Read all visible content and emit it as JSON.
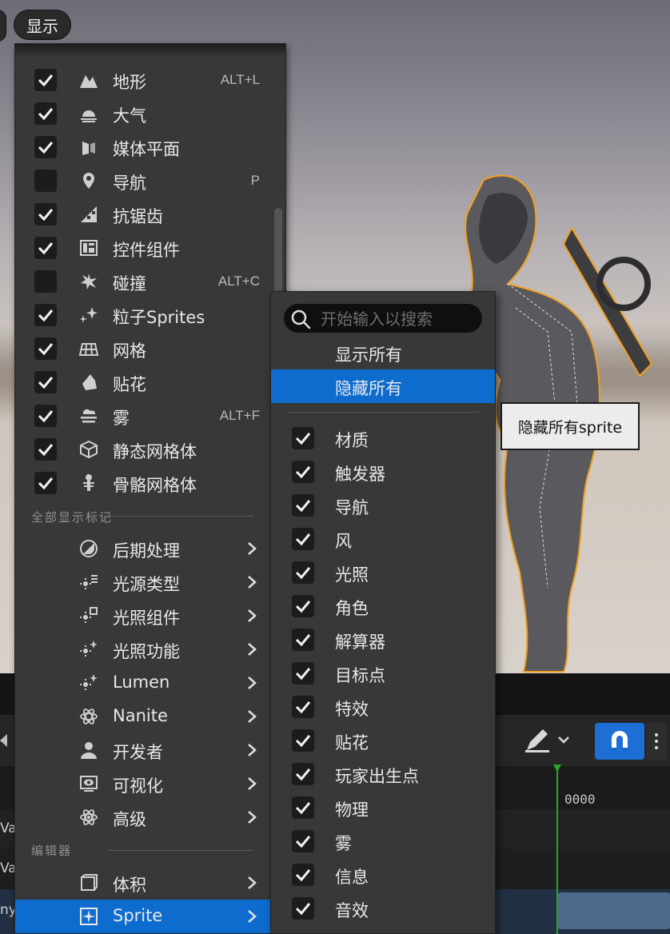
{
  "toolbar": {
    "show_label": "显示"
  },
  "show_menu": {
    "items": [
      {
        "label": "地形",
        "shortcut": "ALT+L",
        "checked": true,
        "icon": "landscape-icon"
      },
      {
        "label": "大气",
        "shortcut": "",
        "checked": true,
        "icon": "atmosphere-icon"
      },
      {
        "label": "媒体平面",
        "shortcut": "",
        "checked": true,
        "icon": "media-plane-icon"
      },
      {
        "label": "导航",
        "shortcut": "P",
        "checked": false,
        "icon": "navigation-pin-icon"
      },
      {
        "label": "抗锯齿",
        "shortcut": "",
        "checked": true,
        "icon": "anti-aliasing-icon"
      },
      {
        "label": "控件组件",
        "shortcut": "",
        "checked": true,
        "icon": "widget-component-icon"
      },
      {
        "label": "碰撞",
        "shortcut": "ALT+C",
        "checked": false,
        "icon": "collision-icon"
      },
      {
        "label": "粒子Sprites",
        "shortcut": "",
        "checked": true,
        "icon": "particle-sprites-icon"
      },
      {
        "label": "网格",
        "shortcut": "",
        "checked": true,
        "icon": "grid-icon"
      },
      {
        "label": "贴花",
        "shortcut": "",
        "checked": true,
        "icon": "decal-icon"
      },
      {
        "label": "雾",
        "shortcut": "ALT+F",
        "checked": true,
        "icon": "fog-icon"
      },
      {
        "label": "静态网格体",
        "shortcut": "",
        "checked": true,
        "icon": "static-mesh-icon"
      },
      {
        "label": "骨骼网格体",
        "shortcut": "",
        "checked": true,
        "icon": "skeletal-mesh-icon"
      }
    ],
    "section_all_flags": "全部显示标记",
    "submenus": [
      {
        "label": "后期处理",
        "icon": "post-process-icon"
      },
      {
        "label": "光源类型",
        "icon": "light-types-icon"
      },
      {
        "label": "光照组件",
        "icon": "lighting-components-icon"
      },
      {
        "label": "光照功能",
        "icon": "lighting-features-icon"
      },
      {
        "label": "Lumen",
        "icon": "lumen-icon"
      },
      {
        "label": "Nanite",
        "icon": "nanite-icon"
      },
      {
        "label": "开发者",
        "icon": "developer-icon"
      },
      {
        "label": "可视化",
        "icon": "visualize-icon"
      },
      {
        "label": "高级",
        "icon": "advanced-icon"
      }
    ],
    "section_editor": "编辑器",
    "editor_submenus": [
      {
        "label": "体积",
        "icon": "volume-icon",
        "selected": false
      },
      {
        "label": "Sprite",
        "icon": "sprite-icon",
        "selected": true
      }
    ]
  },
  "sprite_menu": {
    "search_placeholder": "开始输入以搜索",
    "show_all": "显示所有",
    "hide_all": "隐藏所有",
    "items": [
      {
        "label": "材质",
        "checked": true
      },
      {
        "label": "触发器",
        "checked": true
      },
      {
        "label": "导航",
        "checked": true
      },
      {
        "label": "风",
        "checked": true
      },
      {
        "label": "光照",
        "checked": true
      },
      {
        "label": "角色",
        "checked": true
      },
      {
        "label": "解算器",
        "checked": true
      },
      {
        "label": "目标点",
        "checked": true
      },
      {
        "label": "特效",
        "checked": true
      },
      {
        "label": "贴花",
        "checked": true
      },
      {
        "label": "玩家出生点",
        "checked": true
      },
      {
        "label": "物理",
        "checked": true
      },
      {
        "label": "雾",
        "checked": true
      },
      {
        "label": "信息",
        "checked": true
      },
      {
        "label": "音效",
        "checked": true
      }
    ]
  },
  "tooltip": {
    "text": "隐藏所有sprite"
  },
  "sequencer": {
    "time": "0000",
    "row_labels": [
      "Va",
      "Va",
      "ny"
    ]
  },
  "colors": {
    "accent": "#0e6ccf",
    "menu_bg": "#383838",
    "selection_outline": "#f0a020",
    "playhead": "#29a329"
  }
}
